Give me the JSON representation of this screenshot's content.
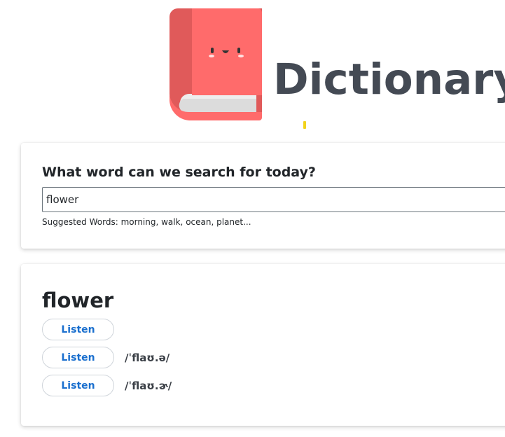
{
  "header": {
    "brand": "Dictionary",
    "logo_icon": "book-mascot-icon",
    "colors": {
      "book_cover": "#ff6b6b",
      "book_spine": "#e05a5a",
      "brand_text": "#444a54"
    }
  },
  "search": {
    "heading": "What word can we search for today?",
    "value": "flower",
    "suggestions": "Suggested Words: morning, walk, ocean, planet..."
  },
  "result": {
    "word": "flower",
    "phonetics": [
      {
        "listen_label": "Listen",
        "text": ""
      },
      {
        "listen_label": "Listen",
        "text": "/ˈflaʊ.ə/"
      },
      {
        "listen_label": "Listen",
        "text": "/ˈflaʊ.ɚ/"
      }
    ],
    "colors": {
      "listen_text": "#1a6fce"
    }
  }
}
